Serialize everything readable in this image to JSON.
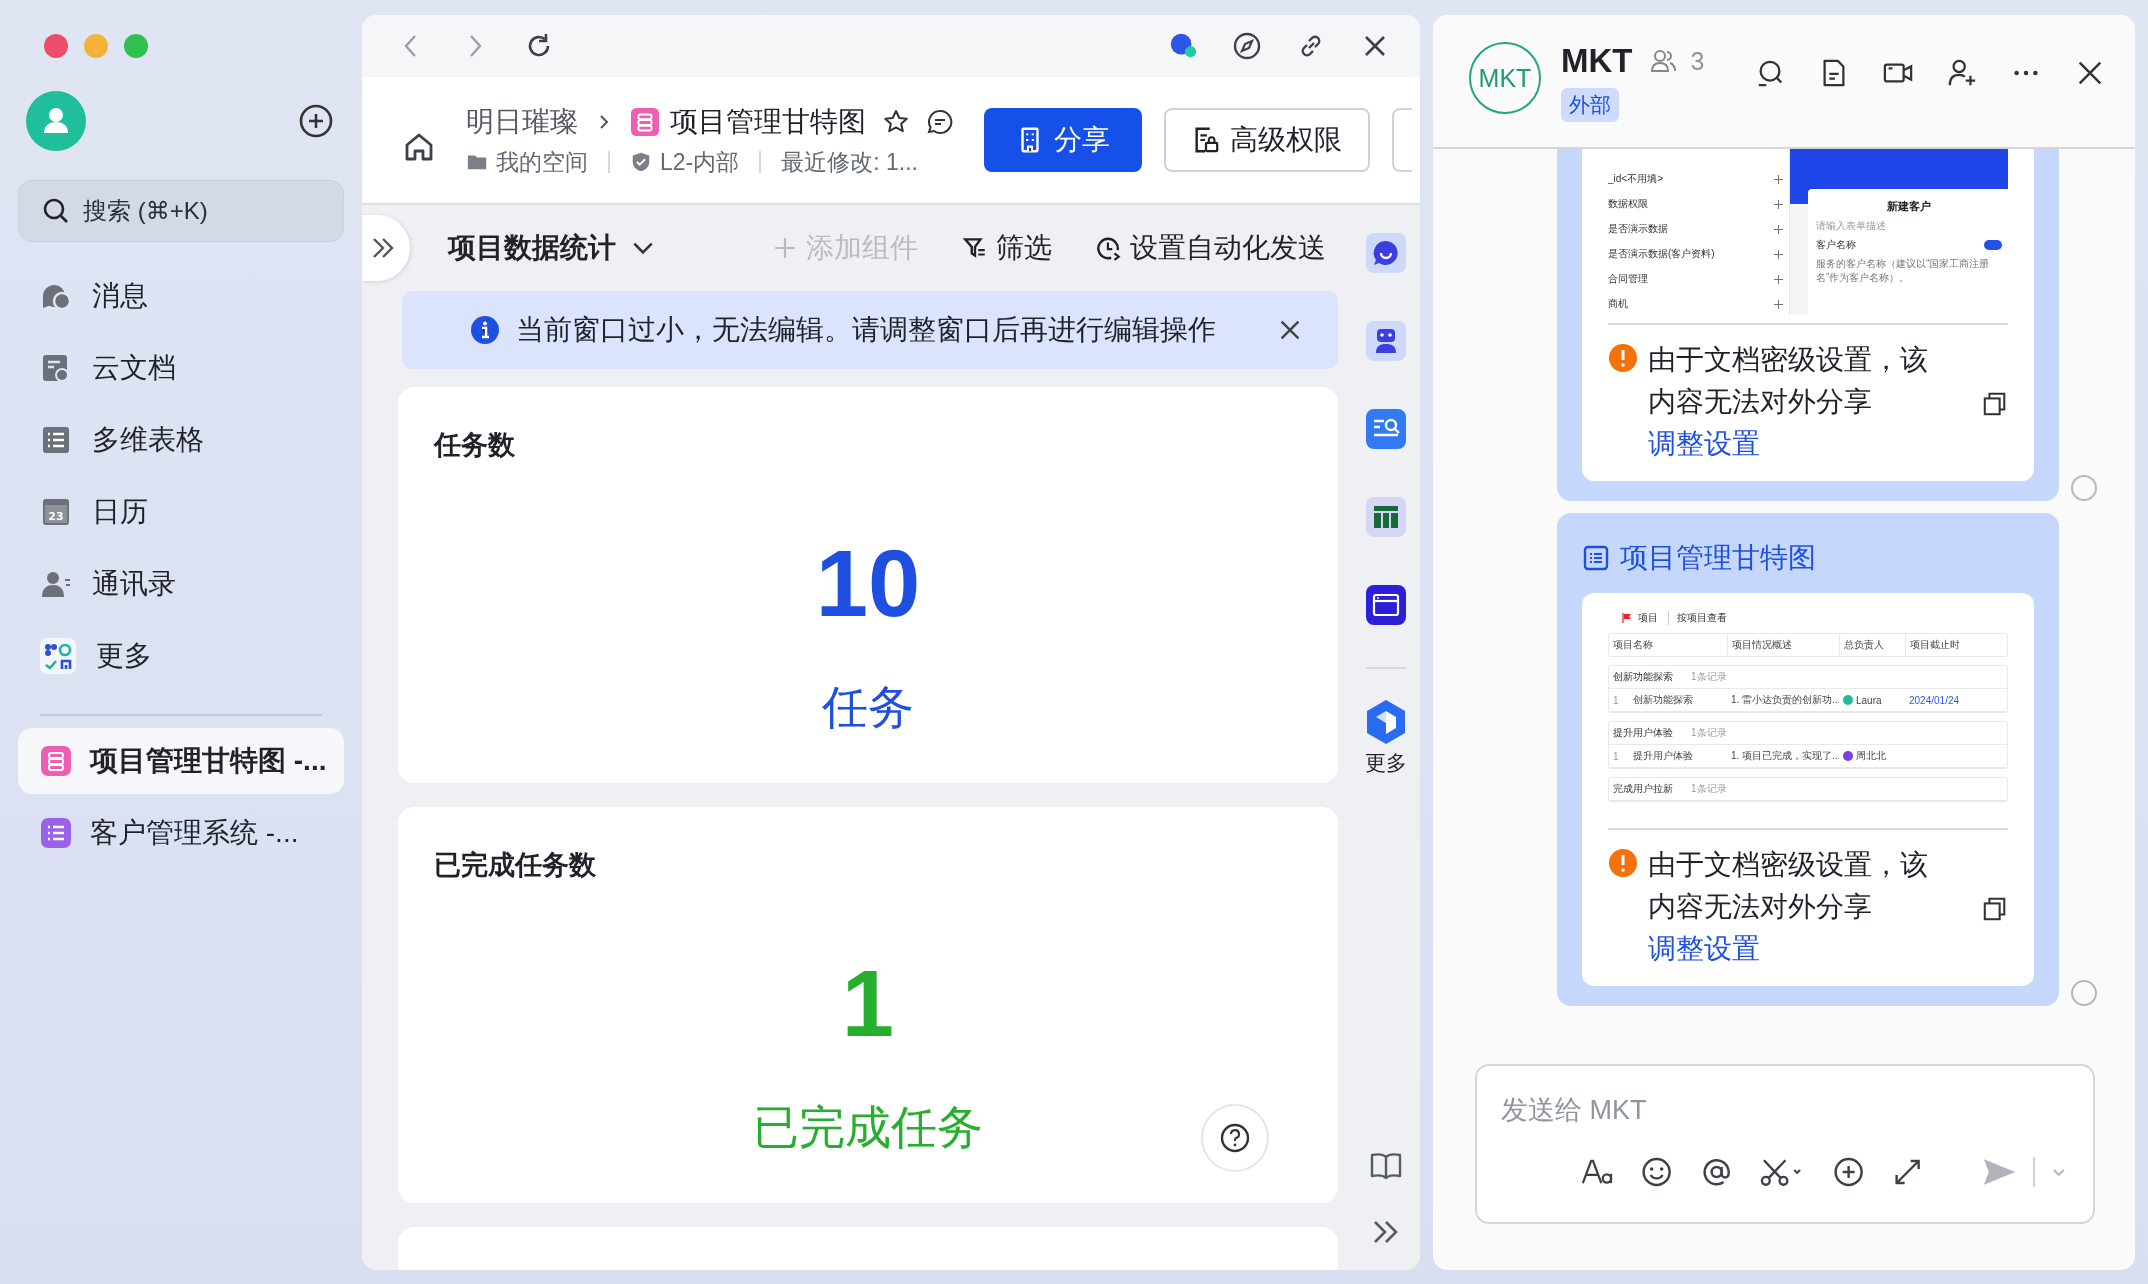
{
  "sidebar": {
    "search": {
      "placeholder": "搜索 (⌘+K)"
    },
    "nav_items": [
      {
        "label": "消息"
      },
      {
        "label": "云文档"
      },
      {
        "label": "多维表格"
      },
      {
        "label": "日历",
        "icon_text": "23"
      },
      {
        "label": "通讯录"
      },
      {
        "label": "更多"
      }
    ],
    "recent_docs": [
      {
        "label": "项目管理甘特图 -...",
        "kind": "gantt",
        "selected": true
      },
      {
        "label": "客户管理系统 -...",
        "kind": "list",
        "selected": false
      }
    ]
  },
  "document": {
    "breadcrumb": {
      "space": "明日璀璨",
      "title": "项目管理甘特图"
    },
    "meta": {
      "folder": "我的空间",
      "security": "L2-内部",
      "modified": "最近修改: 1..."
    },
    "buttons": [
      {
        "label": "分享",
        "kind": "primary"
      },
      {
        "label": "高级权限",
        "kind": "secondary"
      }
    ],
    "toolbar": {
      "view": "项目数据统计",
      "actions": [
        {
          "label": "添加组件",
          "kind": "add",
          "disabled": true
        },
        {
          "label": "筛选",
          "kind": "filter",
          "disabled": false
        },
        {
          "label": "设置自动化发送",
          "kind": "schedule",
          "disabled": false
        }
      ]
    },
    "notice": "当前窗口过小，无法编辑。请调整窗口后再进行编辑操作",
    "cards": [
      {
        "title": "任务数",
        "value": "10",
        "unit": "任务",
        "color": "#1f4fe0"
      },
      {
        "title": "已完成任务数",
        "value": "1",
        "unit": "已完成任务",
        "color": "#28ae2e"
      }
    ]
  },
  "side_rail": {
    "more_label": "更多"
  },
  "chat": {
    "avatar": "MKT",
    "name": "MKT",
    "member_count": "3",
    "badge": "外部",
    "messages": [
      {
        "kind": "form_preview",
        "preview": {
          "fields": [
            "_id<不用填>",
            "数据权限",
            "是否演示数据",
            "是否演示数据(客户资料)",
            "合同管理",
            "商机"
          ],
          "form_title": "新建客户",
          "form_description": "请输入表单描述",
          "field_label": "客户名称",
          "field_required": true,
          "field_hint": "服务的客户名称（建议以“国家工商注册名”作为客户名称）。"
        },
        "warning": "由于文档密级设置，该内容无法对外分享",
        "link": "调整设置",
        "selected": false
      },
      {
        "kind": "gantt_preview",
        "title": "项目管理甘特图",
        "preview": {
          "breadcrumb": [
            "项目",
            "按项目查看"
          ],
          "columns": [
            "项目名称",
            "项目情况概述",
            "总负责人",
            "项目截止时"
          ],
          "groups": [
            {
              "name": "创新功能探索",
              "count": "1条记录",
              "rows": [
                {
                  "index": "1",
                  "name": "创新功能探索",
                  "summary": "1. 雷小达负责的创新功...",
                  "owner": "Laura",
                  "color": "#22b99a",
                  "deadline": "2024/01/24"
                }
              ]
            },
            {
              "name": "提升用户体验",
              "count": "1条记录",
              "rows": [
                {
                  "index": "1",
                  "name": "提升用户体验",
                  "summary": "1. 项目已完成，实现了...",
                  "owner": "周北北",
                  "color": "#7b3fe4"
                }
              ]
            },
            {
              "name": "完成用户拉新",
              "count": "1条记录"
            }
          ]
        },
        "warning": "由于文档密级设置，该内容无法对外分享",
        "link": "调整设置",
        "selected": false
      }
    ],
    "input": {
      "placeholder": "发送给 MKT"
    }
  }
}
